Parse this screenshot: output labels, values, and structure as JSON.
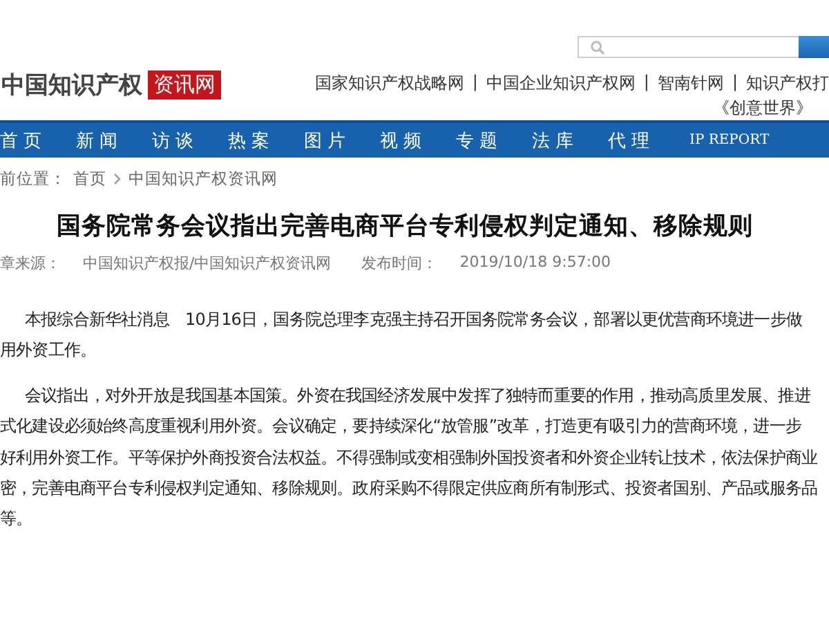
{
  "header": {
    "logo_text": "中国知识产权",
    "logo_badge": "资讯网",
    "links": [
      "国家知识产权战略网",
      "中国企业知识产权网",
      "智南针网",
      "知识产权打"
    ],
    "link_separator": "|",
    "links_second_line": "《创意世界》"
  },
  "nav": [
    {
      "label": "首页",
      "selected": false
    },
    {
      "label": "新闻",
      "selected": false
    },
    {
      "label": "访谈",
      "selected": false
    },
    {
      "label": "热案",
      "selected": false
    },
    {
      "label": "图片",
      "selected": false
    },
    {
      "label": "视频",
      "selected": false
    },
    {
      "label": "专题",
      "selected": false
    },
    {
      "label": "法库",
      "selected": false
    },
    {
      "label": "代理",
      "selected": false
    },
    {
      "label": "IP REPORT",
      "selected": false
    }
  ],
  "breadcrumb": {
    "label": "前位置：",
    "items": [
      "首页",
      "中国知识产权资讯网"
    ]
  },
  "article": {
    "title": "国务院常务会议指出完善电商平台专利侵权判定通知、移除规则",
    "meta": [
      {
        "label": "章来源：",
        "value": "中国知识产权报/中国知识产权资讯网"
      },
      {
        "label": "发布时间：",
        "value": "2019/10/18  9:57:00"
      }
    ],
    "paragraphs": [
      [
        "本报综合新华社消息　10月16日，国务院总理李克强主持召开国务院常务会议，部署以更优营商环境进一步做",
        "用外资工作。"
      ],
      [
        "会议指出，对外开放是我国基本国策。外资在我国经济发展中发挥了独特而重要的作用，推动高质里发展、推进",
        "式化建设必须始终高度重视利用外资。会议确定，要持续深化“放管服”改革，打造更有吸引力的营商环境，进一步",
        "好利用外资工作。平等保护外商投资合法权益。不得强制或变相强制外国投资者和外资企业转让技术，依法保护商业",
        "密，完善电商平台专利侵权判定通知、移除规则。政府采购不得限定供应商所有制形式、投资者国别、产品或服务品",
        "等。"
      ]
    ]
  }
}
